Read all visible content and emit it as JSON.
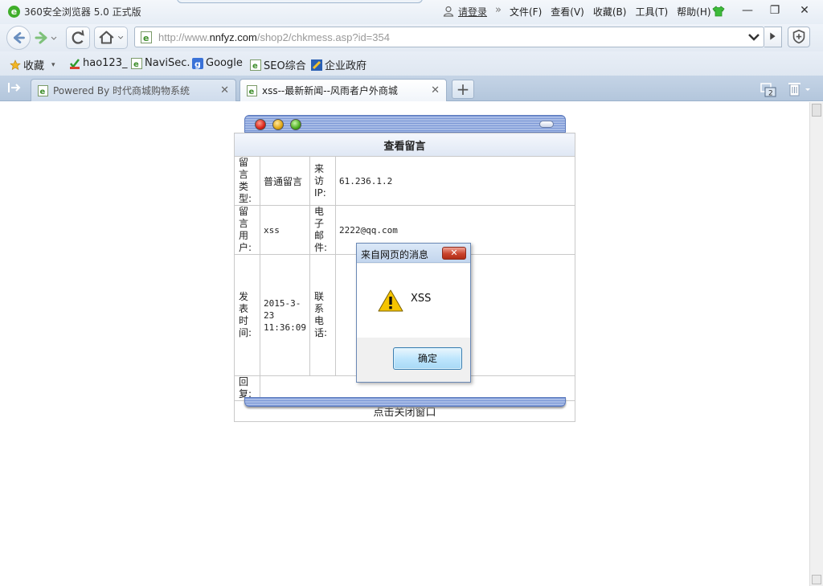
{
  "browser": {
    "title": "360安全浏览器 5.0 正式版",
    "login_label": "请登录",
    "menu_separator": "»",
    "menus": [
      "文件(F)",
      "查看(V)",
      "收藏(B)",
      "工具(T)",
      "帮助(H)"
    ],
    "window_buttons": {
      "minimize": "—",
      "maximize": "❐",
      "close": "✕"
    }
  },
  "nav": {
    "url_prefix": "http://www.",
    "url_domain": "nnfyz.com",
    "url_path": "/shop2/chkmess.asp?id=354"
  },
  "bookmarks": {
    "favorites_label": "收藏",
    "items": [
      "hao123_",
      "NaviSec.",
      "Google",
      "SEO综合",
      "企业政府"
    ]
  },
  "tabs": {
    "items": [
      {
        "label": "Powered By 时代商城购物系统",
        "close": "✕"
      },
      {
        "label": "xss--最新新闻--风雨者户外商城",
        "close": "✕"
      }
    ],
    "new_tab": "+",
    "count": "2"
  },
  "message": {
    "title": "查看留言",
    "rows": [
      {
        "label1": "留言类型:",
        "value1": "普通留言",
        "label2": "来访IP:",
        "value2": "61.236.1.2"
      },
      {
        "label1": "留言用户:",
        "value1": "xss",
        "label2": "电子邮件:",
        "value2": "2222@qq.com"
      },
      {
        "label1": "发表时间:",
        "value1": "2015-3-23 11:36:09",
        "label2": "联系电话:",
        "value2": ""
      }
    ],
    "reply_label": "回复:",
    "reply_value": "",
    "close_window": "点击关闭窗口"
  },
  "alert": {
    "title": "来自网页的消息",
    "text": "XSS",
    "ok": "确定",
    "close": "✕"
  },
  "colors": {
    "accent_blue": "#7b97d6",
    "tab_bar": "#b3c6dc",
    "warning_yellow": "#f5c400"
  }
}
